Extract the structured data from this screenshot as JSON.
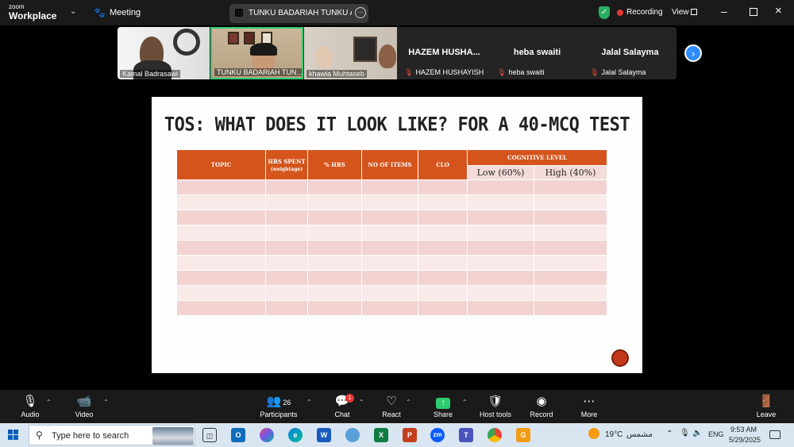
{
  "app": {
    "brand_small": "zoom",
    "brand_large": "Workplace",
    "meeting_label": "Meeting",
    "shared_screen_name": "TUNKU BADARIAH TUNKU AHMA",
    "recording_label": "Recording",
    "view_label": "View"
  },
  "participants_strip": {
    "video_tiles": [
      {
        "name": "Kamal Badrasawi"
      },
      {
        "name": "TUNKU BADARIAH TUN..."
      },
      {
        "name": "khawla Muhtaseb"
      }
    ],
    "name_tiles": [
      {
        "display": "HAZEM  HUSHA...",
        "label": "HAZEM HUSHAYISH"
      },
      {
        "display": "heba swaiti",
        "label": "heba swaiti"
      },
      {
        "display": "Jalal Salayma",
        "label": "Jalal Salayma"
      }
    ]
  },
  "slide": {
    "title": "TOS: WHAT DOES IT LOOK LIKE? FOR A 40-MCQ TEST",
    "columns": {
      "topic": "TOPIC",
      "hrs_spent": "HRS SPENT",
      "hrs_spent_sub": "(weightage)",
      "pct_hrs": "% HRS",
      "no_items": "NO OF ITEMS",
      "clo": "CLO",
      "cognitive": "COGNITIVE LEVEL",
      "low": "Low (60%)",
      "high": "High (40%)"
    }
  },
  "toolbar": {
    "audio": "Audio",
    "video": "Video",
    "participants": "Participants",
    "participants_count": "26",
    "chat": "Chat",
    "chat_badge": "1",
    "react": "React",
    "share": "Share",
    "host_tools": "Host tools",
    "record": "Record",
    "more": "More",
    "leave": "Leave"
  },
  "taskbar": {
    "search_placeholder": "Type here to search",
    "weather_temp": "19°C",
    "weather_label": "مشمس",
    "language": "ENG",
    "time": "9:53 AM",
    "date": "5/29/2025"
  }
}
